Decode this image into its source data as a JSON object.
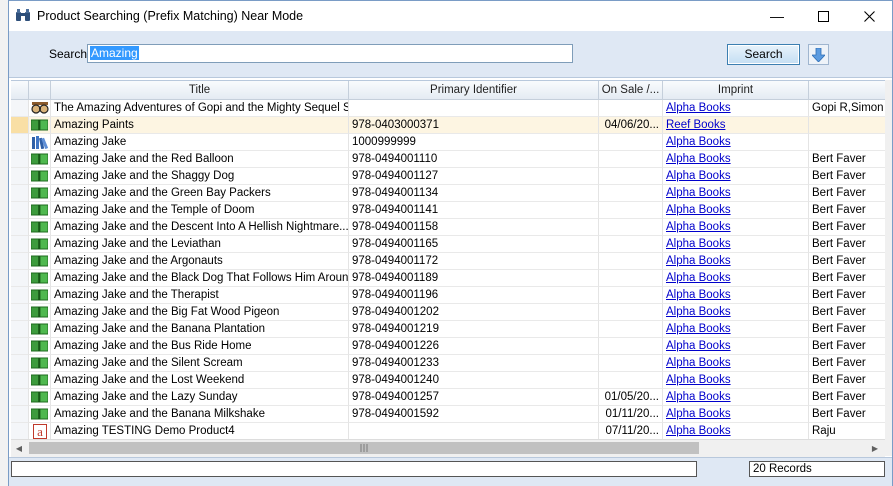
{
  "window": {
    "title": "Product Searching (Prefix Matching) Near Mode",
    "minimize_glyph": "—",
    "maximize_glyph": "☐",
    "close_glyph": "✕"
  },
  "search": {
    "label": "Search",
    "value": "Amazing",
    "button_label": "Search"
  },
  "table": {
    "columns": [
      "Title",
      "Primary Identifier",
      "On Sale /...",
      "Imprint"
    ],
    "rows": [
      {
        "icon": "glasses-icon",
        "title": "The Amazing Adventures of Gopi and the Mighty Sequel S...",
        "pid": "",
        "sale": "",
        "imprint": "Alpha Books",
        "author": "Gopi R,Simon B"
      },
      {
        "icon": "book-icon",
        "title": "Amazing Paints",
        "pid": "978-0403000371",
        "sale": "04/06/20...",
        "imprint": "Reef Books",
        "author": ""
      },
      {
        "icon": "books-shelf-icon",
        "title": "Amazing Jake",
        "pid": "1000999999",
        "sale": "",
        "imprint": "Alpha Books",
        "author": ""
      },
      {
        "icon": "book-icon",
        "title": "Amazing Jake and the Red Balloon",
        "pid": "978-0494001110",
        "sale": "",
        "imprint": "Alpha Books",
        "author": "Bert Faver"
      },
      {
        "icon": "book-icon",
        "title": "Amazing Jake and the Shaggy Dog",
        "pid": "978-0494001127",
        "sale": "",
        "imprint": "Alpha Books",
        "author": "Bert Faver"
      },
      {
        "icon": "book-icon",
        "title": "Amazing Jake and the Green Bay Packers",
        "pid": "978-0494001134",
        "sale": "",
        "imprint": "Alpha Books",
        "author": "Bert Faver"
      },
      {
        "icon": "book-icon",
        "title": "Amazing Jake and the Temple of Doom",
        "pid": "978-0494001141",
        "sale": "",
        "imprint": "Alpha Books",
        "author": "Bert Faver"
      },
      {
        "icon": "book-icon",
        "title": "Amazing Jake and the Descent Into A Hellish Nightmare...",
        "pid": "978-0494001158",
        "sale": "",
        "imprint": "Alpha Books",
        "author": "Bert Faver"
      },
      {
        "icon": "book-icon",
        "title": "Amazing Jake and the Leviathan",
        "pid": "978-0494001165",
        "sale": "",
        "imprint": "Alpha Books",
        "author": "Bert Faver"
      },
      {
        "icon": "book-icon",
        "title": "Amazing Jake and the Argonauts",
        "pid": "978-0494001172",
        "sale": "",
        "imprint": "Alpha Books",
        "author": "Bert Faver"
      },
      {
        "icon": "book-icon",
        "title": "Amazing Jake and the Black Dog That Follows Him Around",
        "pid": "978-0494001189",
        "sale": "",
        "imprint": "Alpha Books",
        "author": "Bert Faver"
      },
      {
        "icon": "book-icon",
        "title": "Amazing Jake and the Therapist",
        "pid": "978-0494001196",
        "sale": "",
        "imprint": "Alpha Books",
        "author": "Bert Faver"
      },
      {
        "icon": "book-icon",
        "title": "Amazing Jake and the Big Fat Wood Pigeon",
        "pid": "978-0494001202",
        "sale": "",
        "imprint": "Alpha Books",
        "author": "Bert Faver"
      },
      {
        "icon": "book-icon",
        "title": "Amazing Jake and the Banana Plantation",
        "pid": "978-0494001219",
        "sale": "",
        "imprint": "Alpha Books",
        "author": "Bert Faver"
      },
      {
        "icon": "book-icon",
        "title": "Amazing Jake and the Bus Ride Home",
        "pid": "978-0494001226",
        "sale": "",
        "imprint": "Alpha Books",
        "author": "Bert Faver"
      },
      {
        "icon": "book-icon",
        "title": "Amazing Jake and the Silent Scream",
        "pid": "978-0494001233",
        "sale": "",
        "imprint": "Alpha Books",
        "author": "Bert Faver"
      },
      {
        "icon": "book-icon",
        "title": "Amazing Jake and the Lost Weekend",
        "pid": "978-0494001240",
        "sale": "",
        "imprint": "Alpha Books",
        "author": "Bert Faver"
      },
      {
        "icon": "book-icon",
        "title": "Amazing Jake and the Lazy Sunday",
        "pid": "978-0494001257",
        "sale": "01/05/20...",
        "imprint": "Alpha Books",
        "author": "Bert Faver"
      },
      {
        "icon": "book-icon",
        "title": "Amazing Jake and the Banana Milkshake",
        "pid": "978-0494001592",
        "sale": "01/11/20...",
        "imprint": "Alpha Books",
        "author": "Bert Faver"
      },
      {
        "icon": "letter-a-icon",
        "title": "Amazing TESTING Demo Product4",
        "pid": "",
        "sale": "07/11/20...",
        "imprint": "Alpha Books",
        "author": "Raju"
      }
    ]
  },
  "status": {
    "records": "20 Records"
  },
  "colors": {
    "accent": "#3399ff",
    "link": "#0000cc",
    "selected_row": "#fdf5e2",
    "toolbar_bg": "#dfe8f4"
  }
}
